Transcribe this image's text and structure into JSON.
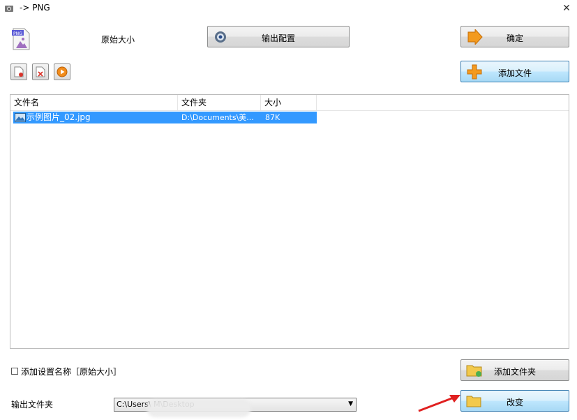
{
  "window": {
    "title": "-> PNG"
  },
  "top": {
    "size_label": "原始大小",
    "output_config_label": "输出配置",
    "ok_label": "确定",
    "add_file_label": "添加文件"
  },
  "filelist": {
    "columns": [
      "文件名",
      "文件夹",
      "大小"
    ],
    "rows": [
      {
        "name": "示例图片_02.jpg",
        "folder": "D:\\Documents\\美...",
        "size": "87K"
      }
    ]
  },
  "bottom": {
    "checkbox_label": "添加设置名称［原始大小］",
    "add_folder_label": "添加文件夹",
    "output_folder_label": "输出文件夹",
    "output_folder_value": "C:\\Users\\                                   M\\Desktop",
    "change_label": "改变"
  },
  "colors": {
    "selection": "#3399ff",
    "accent_orange": "#f39a1e"
  }
}
